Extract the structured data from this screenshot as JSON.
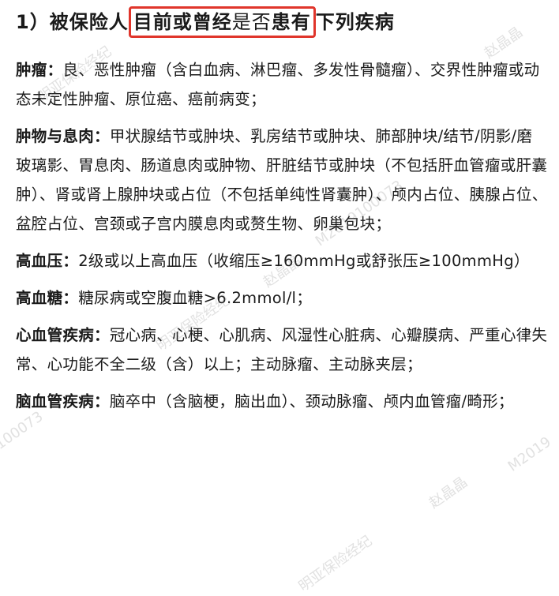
{
  "heading": {
    "prefix": "1）被保险人",
    "highlight_bold1": "目前或曾经",
    "highlight_normal": "是否",
    "highlight_bold2": "患有",
    "suffix": "下列疾病",
    "highlight_color": "#e0352b"
  },
  "items": [
    {
      "term": "肿瘤：",
      "text": "良、恶性肿瘤（含白血病、淋巴瘤、多发性骨髓瘤）、交界性肿瘤或动态未定性肿瘤、原位癌、癌前病变；"
    },
    {
      "term": "肿物与息肉：",
      "text": "甲状腺结节或肿块、乳房结节或肿块、肺部肿块/结节/阴影/磨玻璃影、胃息肉、肠道息肉或肿物、肝脏结节或肿块（不包括肝血管瘤或肝囊肿）、肾或肾上腺肿块或占位（不包括单纯性肾囊肿）、颅内占位、胰腺占位、盆腔占位、宫颈或子宫内膜息肉或赘生物、卵巢包块；"
    },
    {
      "term": "高血压：",
      "text": "2级或以上高血压（收缩压≥160mmHg或舒张压≥100mmHg）"
    },
    {
      "term": "高血糖：",
      "text": "糖尿病或空腹血糖>6.2mmol/l；"
    },
    {
      "term": "心血管疾病：",
      "text": "冠心病、心梗、心肌病、风湿性心脏病、心瓣膜病、严重心律失常、心功能不全二级（含）以上；主动脉瘤、主动脉夹层；"
    },
    {
      "term": "脑血管疾病：",
      "text": "脑卒中（含脑梗，脑出血）、颈动脉瘤、颅内血管瘤/畸形；"
    }
  ],
  "watermarks": {
    "w1": "明亚保险经纪",
    "w2": "M2019100073",
    "w3": "赵晶晶",
    "w4": "明亚保险经纪",
    "w5": "100073",
    "w6": "赵晶晶",
    "w7": "明亚保险经纪",
    "w8": "赵晶晶",
    "w9": "M2019"
  }
}
